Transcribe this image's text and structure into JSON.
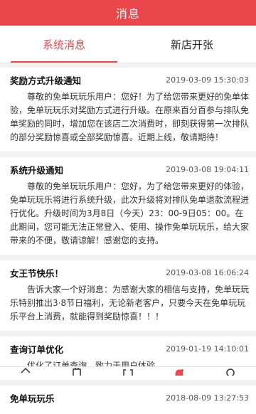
{
  "header": {
    "title": "消息"
  },
  "tabs": [
    {
      "label": "系统消息",
      "active": true
    },
    {
      "label": "新店开张",
      "active": false
    }
  ],
  "messages": [
    {
      "title": "奖励方式升级通知",
      "date": "2019-03-09 15:30:03",
      "body": "尊敬的免单玩玩乐用户：您好！为了给您带来更好的免单体验，免单玩玩乐对奖励方式进行升级。在原来百分百参与排队免单奖励的同时，增加您在该店二次消费时，即刻获得第一次排队的部分奖励惊喜或全部奖励惊喜。近期上线，敬请期待！"
    },
    {
      "title": "系统升级通知",
      "date": "2019-03-08 19:04:11",
      "body": "尊敬的免单玩玩乐用户：您好，为了给您带来更好的体验，免单玩玩乐将进行系统升级，此次升级将对排队免单退款流程进行优化。升级时间为3月8日（今天）23：00-9日05：00。在此期间，您可能无法正常登入、使用、操作免单玩玩乐，给大家带来的不便，敬请谅解！感谢您的支持。"
    },
    {
      "title": "女王节快乐！",
      "date": "2019-03-08 16:06:24",
      "body": "告诉大家一个好消息：为感谢大家的相信与支持，免单玩玩乐特别推出3·8节日福利，无论新老客户，只要今天在免单玩玩乐平台上消费，就能得到奖励惊喜！！！"
    },
    {
      "title": "查询订单优化",
      "date": "2019-01-19 14:10:01",
      "body": "优化了订单查询，致力于用户体验"
    },
    {
      "title": "免单玩玩乐",
      "date": "2018-08-09 13:27:53",
      "body": ""
    }
  ],
  "bottom_nav": {
    "icons": [
      "home-icon",
      "shop-icon",
      "scan-icon",
      "message-icon",
      "user-icon"
    ],
    "accent": "#e9474a"
  },
  "colors": {
    "brand": "#e9474a",
    "background": "#f2f2f2"
  }
}
